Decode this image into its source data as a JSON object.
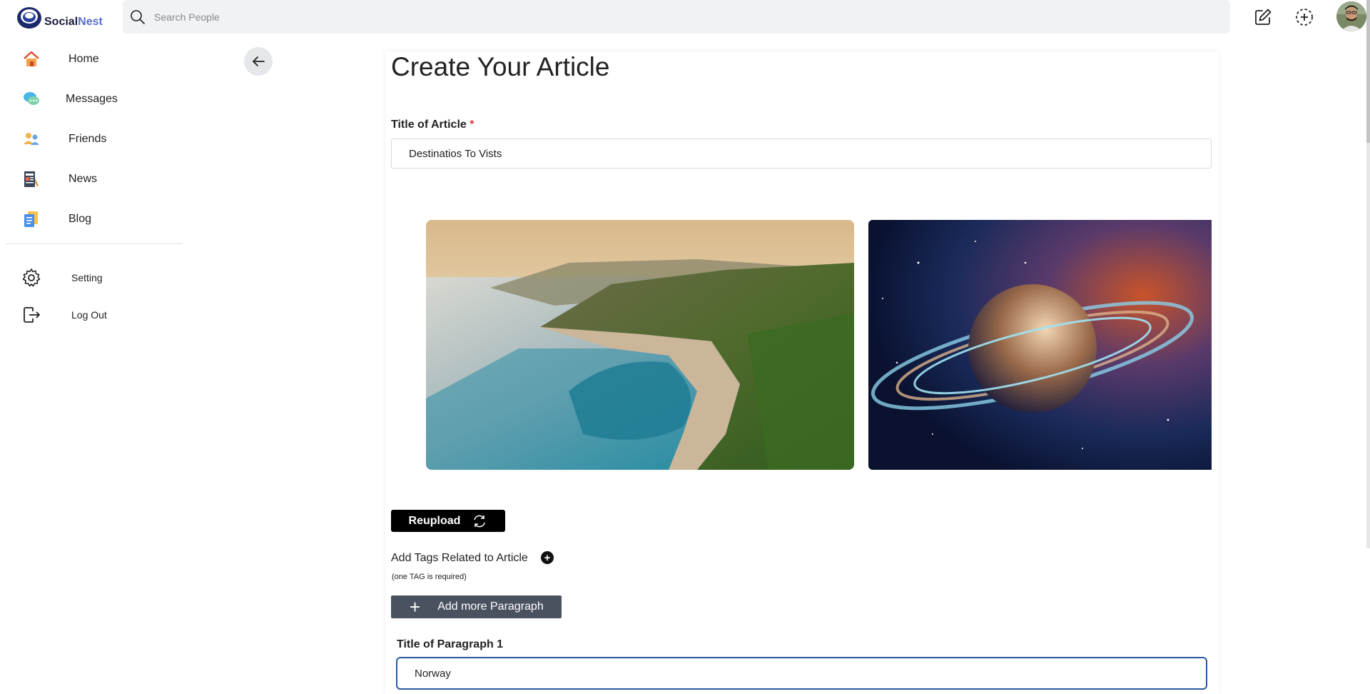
{
  "app": {
    "logo_primary": "Social",
    "logo_secondary": "Nest"
  },
  "search": {
    "placeholder": "Search People",
    "value": ""
  },
  "sidebar": {
    "items": [
      {
        "label": "Home",
        "icon": "home-icon"
      },
      {
        "label": "Messages",
        "icon": "messages-icon"
      },
      {
        "label": "Friends",
        "icon": "friends-icon"
      },
      {
        "label": "News",
        "icon": "news-icon"
      },
      {
        "label": "Blog",
        "icon": "blog-icon"
      }
    ],
    "secondary": [
      {
        "label": "Setting",
        "icon": "gear-icon"
      },
      {
        "label": "Log Out",
        "icon": "logout-icon"
      }
    ]
  },
  "form": {
    "page_title": "Create Your Article",
    "article_title_label": "Title of Article",
    "required_mark": "*",
    "article_title_value": "Destinatios To Vists",
    "reupload_label": "Reupload",
    "tags_label": "Add Tags Related to Article",
    "tags_note": "(one TAG is required)",
    "add_paragraph_label": "Add more Paragraph",
    "paragraph_title_label": "Title of Paragraph 1",
    "paragraph_title_value": "Norway"
  },
  "colors": {
    "accent": "#5a6fd0",
    "primary_button": "#000000",
    "secondary_button": "#4a5260",
    "required": "#d23a3a",
    "active_input_border": "#2c5aa0"
  }
}
